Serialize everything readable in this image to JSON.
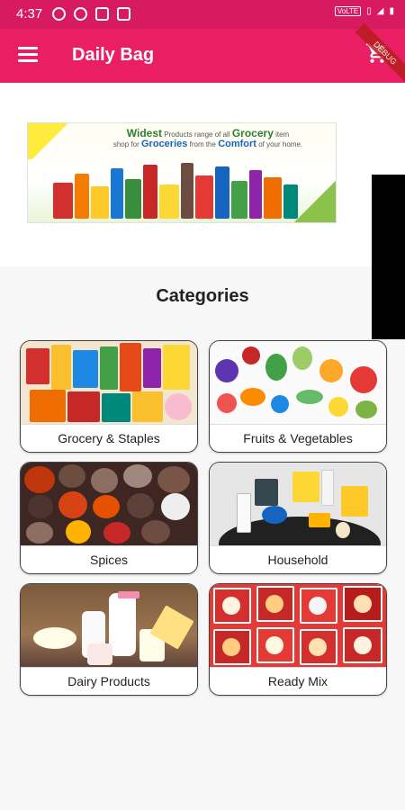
{
  "status_bar": {
    "time": "4:37",
    "network": "VoLTE",
    "background_color": "#d81b60"
  },
  "app_bar": {
    "title": "Daily Bag",
    "menu_icon": "hamburger-menu-icon",
    "cart_icon": "shopping-cart-icon",
    "debug_banner": "DEBUG",
    "background_color": "#e91e63"
  },
  "banner": {
    "text_line1_highlight": "Widest",
    "text_line1_rest": "Products range of all",
    "text_line1_highlight2": "Grocery",
    "text_line1_end": "item",
    "text_line2_start": "shop for",
    "text_line2_highlight": "Groceries",
    "text_line2_mid": "from the",
    "text_line2_highlight2": "Comfort",
    "text_line2_end": "of your home."
  },
  "section": {
    "title": "Categories"
  },
  "categories": [
    {
      "label": "Grocery & Staples"
    },
    {
      "label": "Fruits & Vegetables"
    },
    {
      "label": "Spices"
    },
    {
      "label": "Household"
    },
    {
      "label": "Dairy Products"
    },
    {
      "label": "Ready Mix"
    }
  ]
}
